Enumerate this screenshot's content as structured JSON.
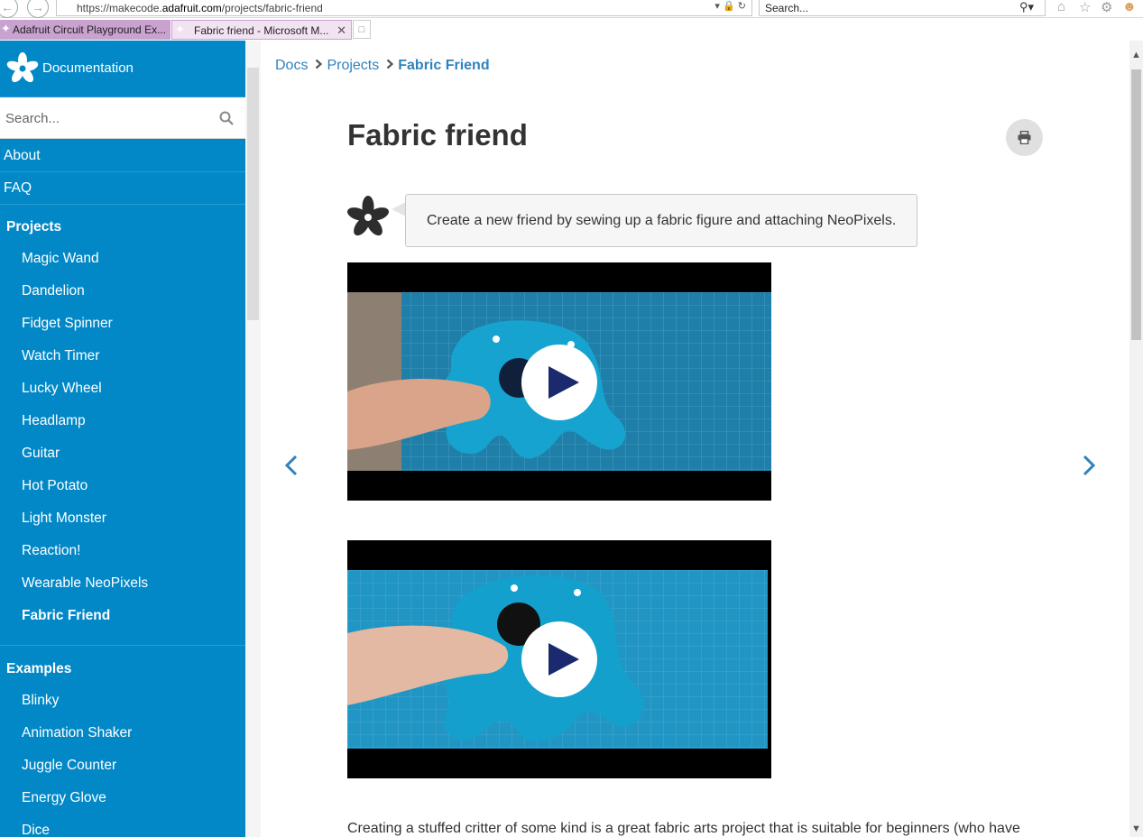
{
  "browser": {
    "url_prefix": "https://makecode.",
    "url_domain": "adafruit.com",
    "url_path": "/projects/fabric-friend",
    "search_placeholder": "Search...",
    "tabs": [
      {
        "label": "Adafruit Circuit Playground Ex...",
        "active": false
      },
      {
        "label": "Fabric friend - Microsoft M...",
        "active": true
      }
    ]
  },
  "sidebar": {
    "brand": "Documentation",
    "search_placeholder": "Search...",
    "top_items": [
      {
        "label": "About"
      },
      {
        "label": "FAQ"
      }
    ],
    "projects_header": "Projects",
    "projects": [
      {
        "label": "Magic Wand"
      },
      {
        "label": "Dandelion"
      },
      {
        "label": "Fidget Spinner"
      },
      {
        "label": "Watch Timer"
      },
      {
        "label": "Lucky Wheel"
      },
      {
        "label": "Headlamp"
      },
      {
        "label": "Guitar"
      },
      {
        "label": "Hot Potato"
      },
      {
        "label": "Light Monster"
      },
      {
        "label": "Reaction!"
      },
      {
        "label": "Wearable NeoPixels"
      },
      {
        "label": "Fabric Friend",
        "current": true
      }
    ],
    "examples_header": "Examples",
    "examples": [
      {
        "label": "Blinky"
      },
      {
        "label": "Animation Shaker"
      },
      {
        "label": "Juggle Counter"
      },
      {
        "label": "Energy Glove"
      },
      {
        "label": "Dice"
      }
    ]
  },
  "main": {
    "breadcrumb": [
      "Docs",
      "Projects",
      "Fabric Friend"
    ],
    "title": "Fabric friend",
    "intro": "Create a new friend by sewing up a fabric figure and attaching NeoPixels.",
    "body_start": "Creating a stuffed critter of some kind is a great fabric arts project that is suitable for beginners (who have"
  },
  "colors": {
    "sidebar_bg": "#0288c7",
    "link": "#2f82bd",
    "play_icon": "#1b2a6e",
    "video_fabric": "#1b9fc7"
  }
}
